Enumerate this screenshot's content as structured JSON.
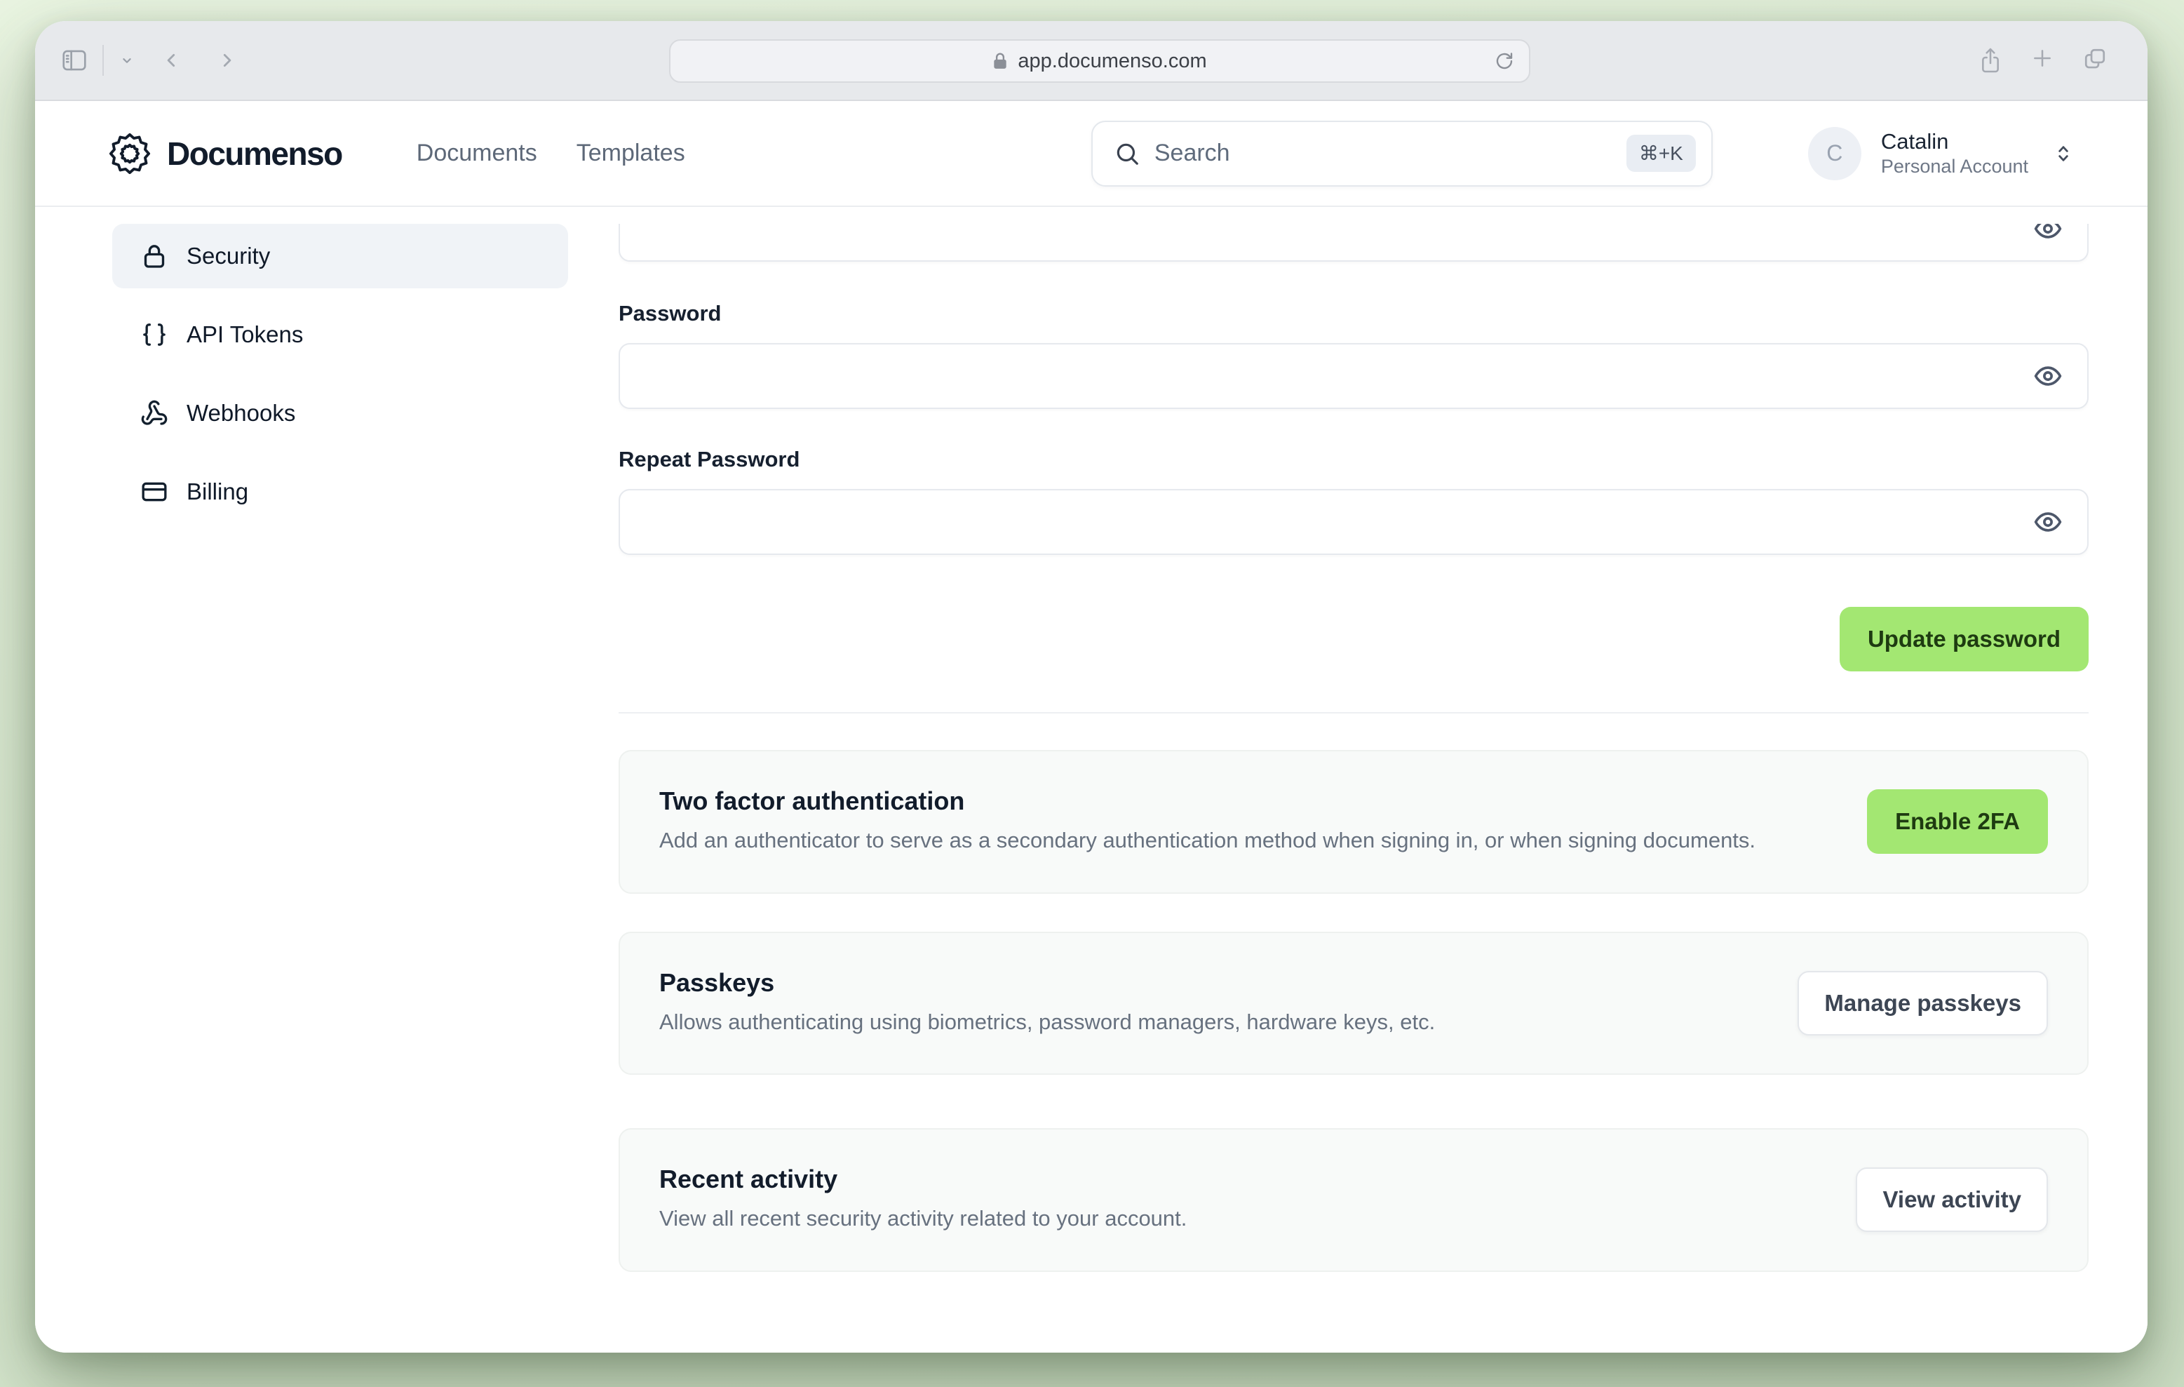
{
  "browser": {
    "url": "app.documenso.com"
  },
  "header": {
    "brand": "Documenso",
    "nav": [
      {
        "label": "Documents"
      },
      {
        "label": "Templates"
      }
    ],
    "search": {
      "placeholder": "Search",
      "shortcut": "⌘+K"
    },
    "account": {
      "initial": "C",
      "name": "Catalin",
      "type": "Personal Account"
    }
  },
  "sidebar": {
    "items": [
      {
        "label": "Security",
        "icon": "lock-icon",
        "active": true
      },
      {
        "label": "API Tokens",
        "icon": "braces-icon",
        "active": false
      },
      {
        "label": "Webhooks",
        "icon": "webhook-icon",
        "active": false
      },
      {
        "label": "Billing",
        "icon": "credit-card-icon",
        "active": false
      }
    ]
  },
  "main": {
    "password_form": {
      "password_label": "Password",
      "repeat_label": "Repeat Password",
      "submit_label": "Update password"
    },
    "cards": [
      {
        "title": "Two factor authentication",
        "description": "Add an authenticator to serve as a secondary authentication method when signing in, or when signing documents.",
        "button": "Enable 2FA"
      },
      {
        "title": "Passkeys",
        "description": "Allows authenticating using biometrics, password managers, hardware keys, etc.",
        "button": "Manage passkeys"
      },
      {
        "title": "Recent activity",
        "description": "View all recent security activity related to your account.",
        "button": "View activity"
      }
    ]
  },
  "colors": {
    "accent_green": "#a3e772",
    "accent_text": "#1e3b11",
    "desktop_green": "#dcebd3"
  }
}
